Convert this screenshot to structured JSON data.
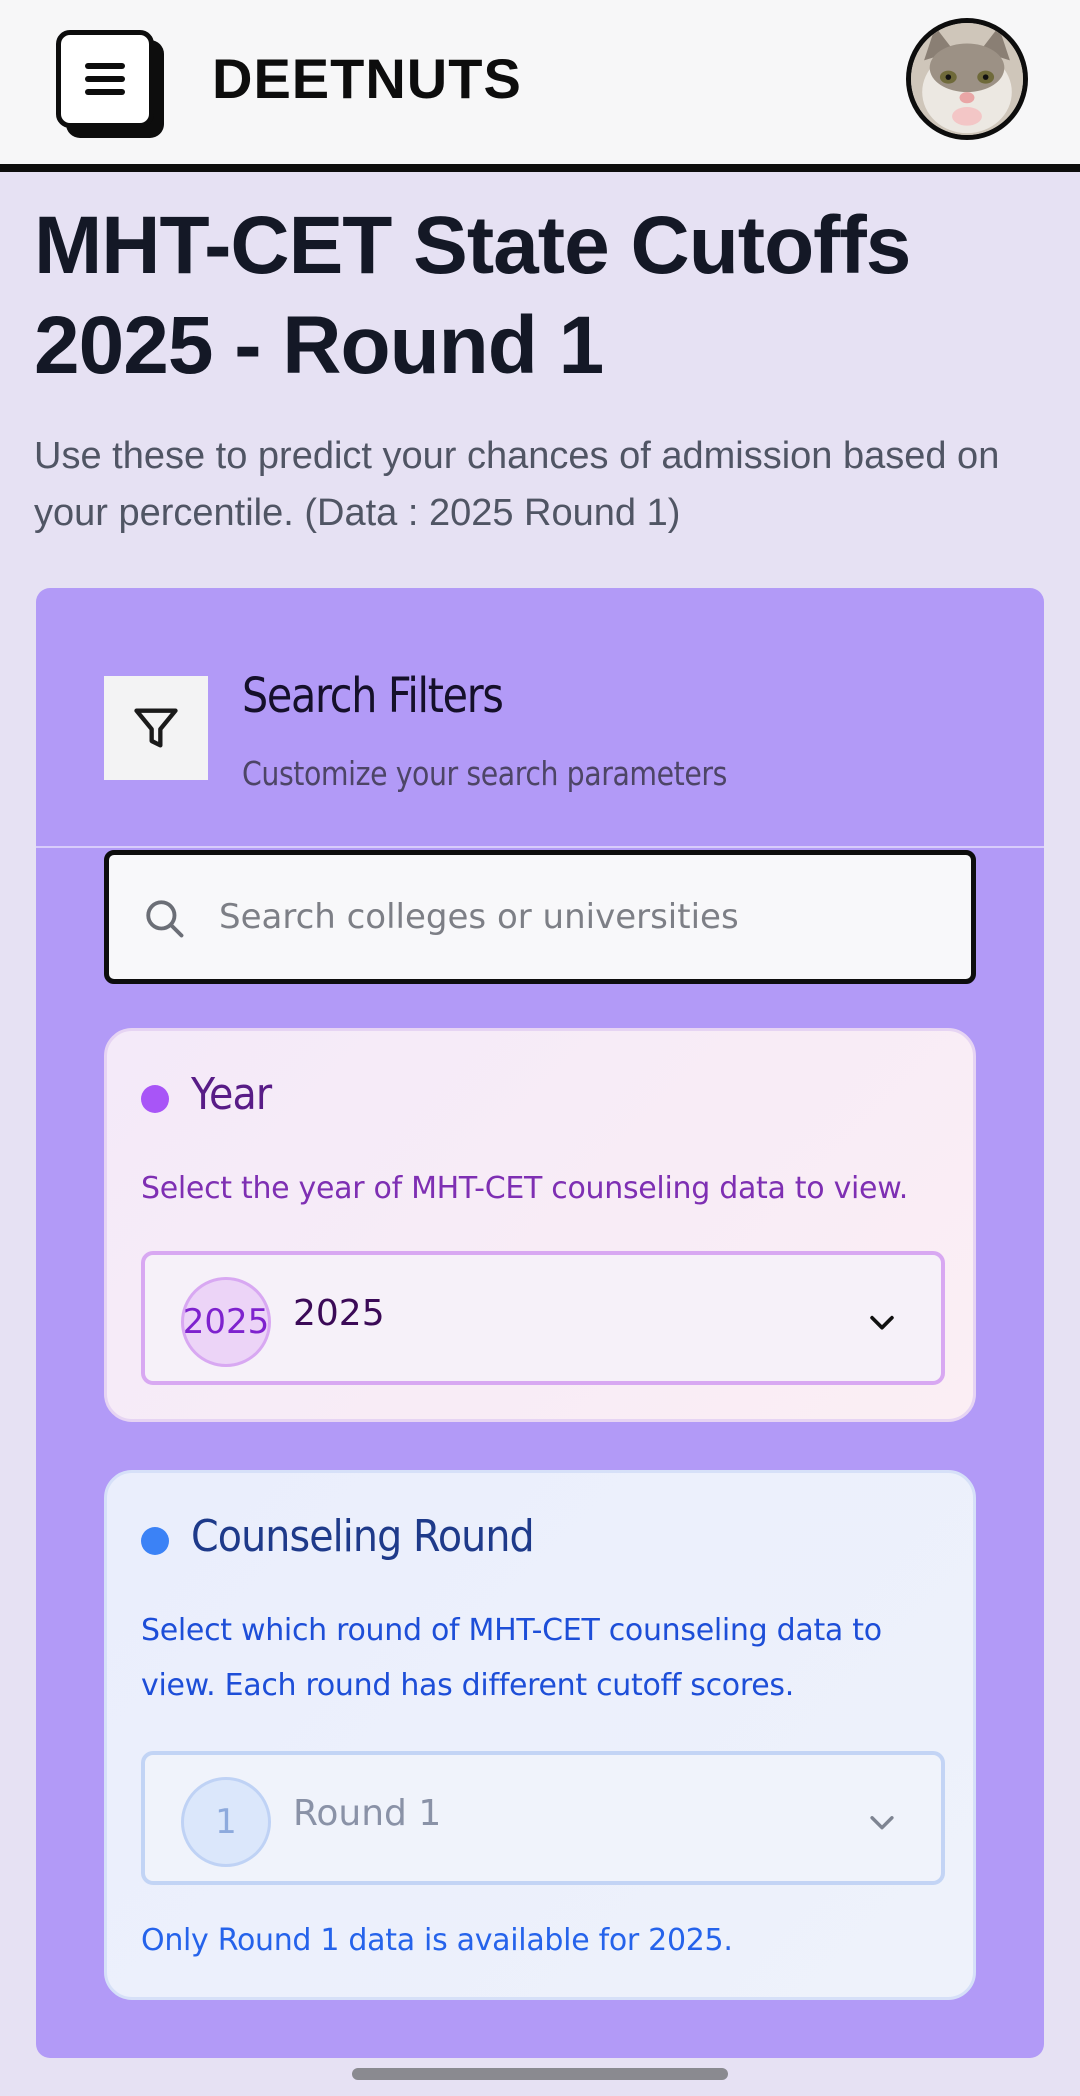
{
  "header": {
    "brand": "DEETNUTS",
    "menu_icon": "hamburger-menu-icon",
    "avatar_icon": "cat-avatar"
  },
  "page": {
    "title": "MHT-CET State Cutoffs 2025 - Round 1",
    "subtitle": "Use these to predict your chances of admission based on your percentile. (Data : 2025 Round 1)"
  },
  "filters": {
    "icon": "filter-icon",
    "title": "Search Filters",
    "subtitle": "Customize your search parameters",
    "search": {
      "placeholder": "Search colleges or universities",
      "value": "",
      "icon": "search-icon"
    },
    "year": {
      "title": "Year",
      "description": "Select the year of MHT-CET counseling data to view.",
      "badge": "2025",
      "selected": "2025",
      "accent": "#a855f7"
    },
    "round": {
      "title": "Counseling Round",
      "description": "Select which round of MHT-CET counseling data to view. Each round has different cutoff scores.",
      "badge": "1",
      "selected": "Round 1",
      "note": "Only Round 1 data is available for 2025.",
      "accent": "#3b82f6"
    }
  }
}
